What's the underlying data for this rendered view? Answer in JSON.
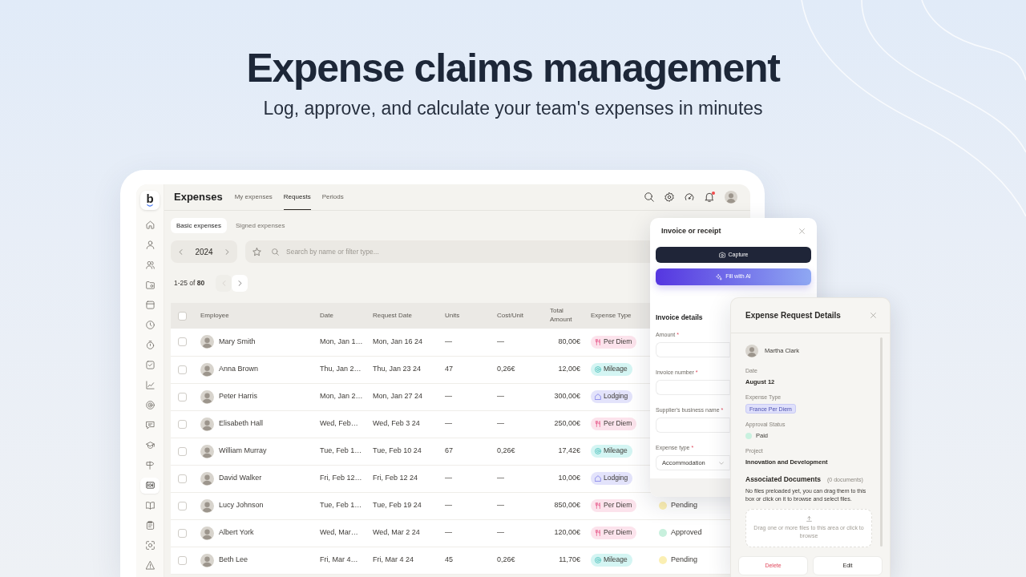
{
  "hero": {
    "title": "Expense claims management",
    "subtitle": "Log, approve, and calculate your team's expenses in minutes"
  },
  "app": {
    "logo": "b",
    "sidebar": {
      "items": [
        {
          "kind": "home",
          "selected": false
        },
        {
          "kind": "user",
          "selected": false
        },
        {
          "kind": "users",
          "selected": false
        },
        {
          "kind": "folder",
          "selected": false
        },
        {
          "kind": "calendar",
          "selected": false
        },
        {
          "kind": "clock",
          "selected": false
        },
        {
          "kind": "stopwatch",
          "selected": false
        },
        {
          "kind": "checklist",
          "selected": false
        },
        {
          "kind": "chart",
          "selected": false
        },
        {
          "kind": "target",
          "selected": false
        },
        {
          "kind": "chat",
          "selected": false
        },
        {
          "kind": "graduation",
          "selected": false
        },
        {
          "kind": "signpost",
          "selected": false
        },
        {
          "kind": "banknote",
          "selected": true
        },
        {
          "kind": "book",
          "selected": false
        },
        {
          "kind": "clipboard",
          "selected": false
        },
        {
          "kind": "scan",
          "selected": false
        },
        {
          "kind": "warning",
          "selected": false
        }
      ]
    },
    "title": "Expenses",
    "tabs": [
      {
        "label": "My expenses",
        "selected": false
      },
      {
        "label": "Requests",
        "selected": true
      },
      {
        "label": "Periods",
        "selected": false
      }
    ],
    "notifications": {
      "unread": true
    },
    "subtabs": [
      {
        "label": "Basic expenses",
        "selected": true
      },
      {
        "label": "Signed expenses",
        "selected": false
      }
    ],
    "year": "2024",
    "search": {
      "placeholder": "Search by name or filter type..."
    },
    "pagination": {
      "summary": "1-25 of **80**",
      "previous": {
        "disabled": true
      },
      "next": {
        "disabled": false
      }
    },
    "table": {
      "all_selected": false,
      "columns": [
        "Employee",
        "Date",
        "Request Date",
        "Units",
        "Cost/Unit",
        "Total Amount",
        "Expense Type"
      ],
      "rows": [
        {
          "checked": false,
          "employee": "Mary Smith",
          "date": "Mon, Jan 1…",
          "request_date": "Mon, Jan 16 24",
          "units": "—",
          "cost_per_unit": "—",
          "total": "80,00€",
          "expense_type": {
            "label": "Per Diem",
            "kind": "per_diem"
          }
        },
        {
          "checked": false,
          "employee": "Anna Brown",
          "date": "Thu, Jan 2…",
          "request_date": "Thu, Jan 23 24",
          "units": "47",
          "cost_per_unit": "0,26€",
          "total": "12,00€",
          "expense_type": {
            "label": "Mileage",
            "kind": "mileage"
          }
        },
        {
          "checked": false,
          "employee": "Peter Harris",
          "date": "Mon, Jan 2…",
          "request_date": "Mon, Jan 27 24",
          "units": "—",
          "cost_per_unit": "—",
          "total": "300,00€",
          "expense_type": {
            "label": "Lodging",
            "kind": "lodging"
          }
        },
        {
          "checked": false,
          "employee": "Elisabeth Hall",
          "date": "Wed, Feb…",
          "request_date": "Wed, Feb 3 24",
          "units": "—",
          "cost_per_unit": "—",
          "total": "250,00€",
          "expense_type": {
            "label": "Per Diem",
            "kind": "per_diem"
          }
        },
        {
          "checked": false,
          "employee": "William Murray",
          "date": "Tue, Feb 1…",
          "request_date": "Tue, Feb 10 24",
          "units": "67",
          "cost_per_unit": "0,26€",
          "total": "17,42€",
          "expense_type": {
            "label": "Mileage",
            "kind": "mileage"
          }
        },
        {
          "checked": false,
          "employee": "David Walker",
          "date": "Fri, Feb 12…",
          "request_date": "Fri, Feb 12 24",
          "units": "—",
          "cost_per_unit": "—",
          "total": "10,00€",
          "expense_type": {
            "label": "Lodging",
            "kind": "lodging"
          }
        },
        {
          "checked": false,
          "employee": "Lucy Johnson",
          "date": "Tue, Feb 1…",
          "request_date": "Tue, Feb 19 24",
          "units": "—",
          "cost_per_unit": "—",
          "total": "850,00€",
          "expense_type": {
            "label": "Per Diem",
            "kind": "per_diem"
          },
          "approval": {
            "label": "Pending",
            "color": "#fbefb3"
          }
        },
        {
          "checked": false,
          "employee": "Albert York",
          "date": "Wed, Mar…",
          "request_date": "Wed, Mar 2 24",
          "units": "—",
          "cost_per_unit": "—",
          "total": "120,00€",
          "expense_type": {
            "label": "Per Diem",
            "kind": "per_diem"
          },
          "approval": {
            "label": "Approved",
            "color": "#c8f0dd"
          }
        },
        {
          "checked": false,
          "employee": "Beth Lee",
          "date": "Fri, Mar 4…",
          "request_date": "Fri, Mar 4 24",
          "units": "45",
          "cost_per_unit": "0,26€",
          "total": "11,70€",
          "expense_type": {
            "label": "Mileage",
            "kind": "mileage"
          },
          "approval": {
            "label": "Pending",
            "color": "#fbefb3"
          }
        }
      ]
    }
  },
  "invoice_panel": {
    "title": "Invoice or receipt",
    "actions": [
      {
        "label": "Capture",
        "kind": "capture"
      },
      {
        "label": "Fill with AI",
        "kind": "ai"
      }
    ],
    "section_title": "Invoice details",
    "fields": [
      {
        "label": "Amount",
        "required_mark": "*",
        "kind": "input"
      },
      {
        "label": "Invoice number",
        "required_mark": "*",
        "kind": "input"
      },
      {
        "label": "Supplier's business name",
        "required_mark": "*",
        "kind": "input"
      },
      {
        "label": "Expense type",
        "required_mark": "*",
        "kind": "select",
        "value": "Accommodation"
      }
    ]
  },
  "details_panel": {
    "title": "Expense Request Details",
    "employee": "Martha Clark",
    "fields": [
      {
        "label": "Date",
        "kind": "text",
        "value": "August 12"
      },
      {
        "label": "Expense Type",
        "kind": "tag",
        "value": "France Per Diem"
      },
      {
        "label": "Approval Status",
        "kind": "status",
        "value": "Paid",
        "color": "#c9f1df"
      },
      {
        "label": "Project",
        "kind": "text",
        "value": "Innovation and Development"
      }
    ],
    "documents": {
      "title": "Associated Documents",
      "count": "(0 documents)",
      "hint": "No files preloaded yet, you can drag them to this box or click on it to browse and select files.",
      "dropzone": "Drag one or more files to this area or click to browse"
    },
    "actions": [
      {
        "label": "Delete",
        "kind": "danger"
      },
      {
        "label": "Edit",
        "kind": "plain"
      }
    ]
  }
}
